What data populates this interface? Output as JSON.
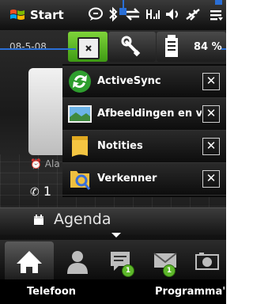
{
  "title_bar": {
    "title": "Start",
    "icons": [
      "windows-logo-icon",
      "messaging-icon",
      "bluetooth-icon",
      "data-connection-icon",
      "signal-icon",
      "volume-icon",
      "ringer-off-icon",
      "menu-icon"
    ]
  },
  "home": {
    "date": "08-5-08",
    "alarm_label": "Ala",
    "phone_value": "1",
    "agenda_label": "Agenda"
  },
  "toolbar": {
    "battery_value": "84 %",
    "buttons": [
      "task-manager",
      "settings",
      "battery"
    ]
  },
  "tasks": [
    {
      "label": "ActiveSync",
      "icon": "activesync-icon"
    },
    {
      "label": "Afbeeldingen en vi...",
      "icon": "pictures-icon"
    },
    {
      "label": "Notities",
      "icon": "notes-icon"
    },
    {
      "label": "Verkenner",
      "icon": "explorer-icon"
    }
  ],
  "tabs": [
    {
      "name": "home",
      "icon": "home-icon",
      "badge": ""
    },
    {
      "name": "contacts",
      "icon": "people-icon",
      "badge": ""
    },
    {
      "name": "messages",
      "icon": "sms-icon",
      "badge": "1"
    },
    {
      "name": "email",
      "icon": "mail-icon",
      "badge": "1"
    },
    {
      "name": "camera",
      "icon": "camera-icon",
      "badge": ""
    }
  ],
  "softkeys": {
    "left": "Telefoon",
    "right": "Programma's"
  },
  "colors": {
    "accent_green": "#5eb82a",
    "callout_blue": "#2a6fd6"
  }
}
